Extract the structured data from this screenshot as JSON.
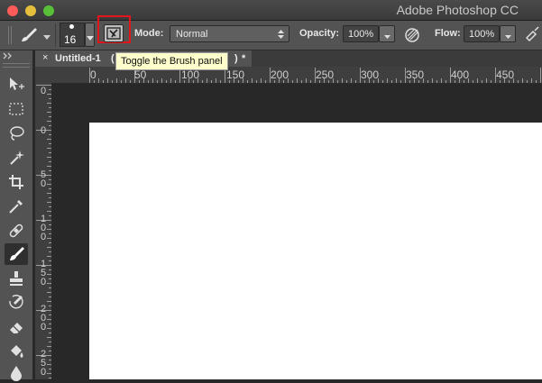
{
  "window": {
    "title": "Adobe Photoshop CC"
  },
  "options_bar": {
    "brush_size": "16",
    "mode_label": "Mode:",
    "mode_value": "Normal",
    "opacity_label": "Opacity:",
    "opacity_value": "100%",
    "flow_label": "Flow:",
    "flow_value": "100%"
  },
  "tooltip": {
    "text": "Toggle the Brush panel"
  },
  "document_tab": {
    "close": "×",
    "title": "Untitled-1",
    "title_suffix": "(",
    "trail": ")",
    "modified": "*"
  },
  "ruler": {
    "horizontal": [
      "0",
      "50",
      "100",
      "150",
      "200",
      "250",
      "300",
      "350",
      "400",
      "450"
    ],
    "vertical_top": "0",
    "vertical": [
      [
        "0"
      ],
      [
        "5",
        "0"
      ],
      [
        "1",
        "0",
        "0"
      ],
      [
        "1",
        "5",
        "0"
      ],
      [
        "2",
        "0",
        "0"
      ],
      [
        "2",
        "5",
        "0"
      ]
    ]
  },
  "highlight_color": "#e4141b",
  "tools": [
    "move-tool",
    "marquee-tool",
    "lasso-tool",
    "magic-wand-tool",
    "crop-tool",
    "eyedropper-tool",
    "healing-brush-tool",
    "brush-tool",
    "clone-stamp-tool",
    "history-brush-tool",
    "eraser-tool",
    "paint-bucket-tool",
    "blur-tool"
  ],
  "selected_tool": "brush-tool"
}
